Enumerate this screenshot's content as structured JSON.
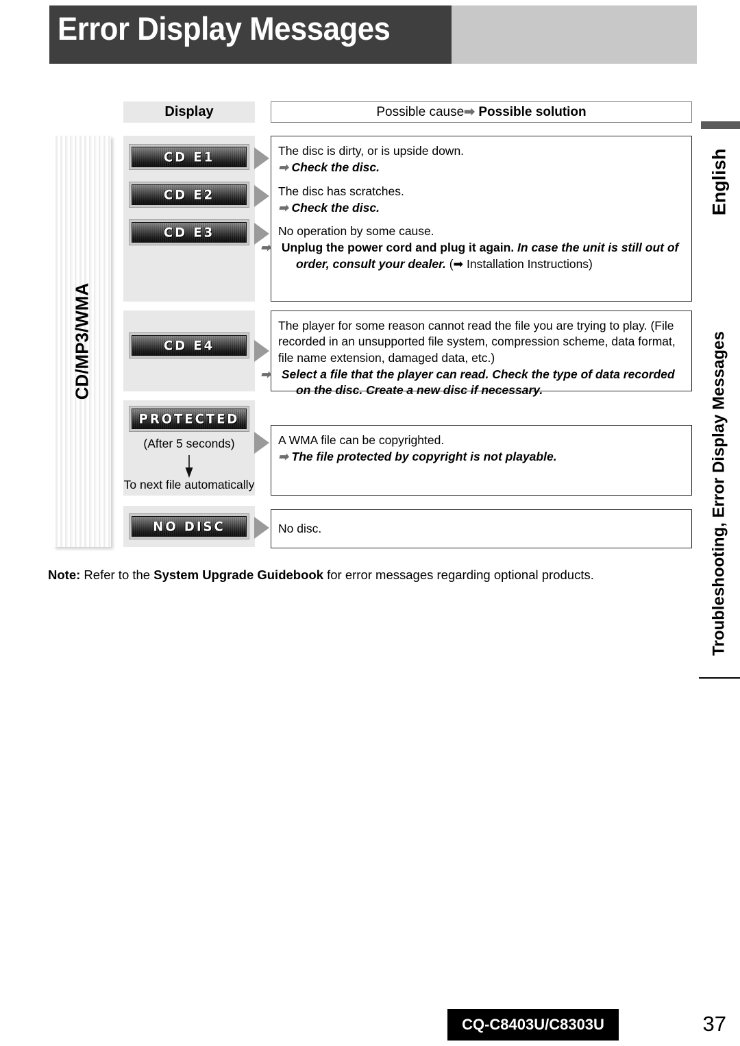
{
  "page": {
    "title": "Error Display Messages",
    "category_tab": "CD/MP3/WMA",
    "language_label": "English",
    "section_label": "Troubleshooting, Error Display Messages",
    "note_prefix": "Note:",
    "note_text_1": " Refer to the ",
    "note_bold": "System Upgrade Guidebook",
    "note_text_2": " for error messages regarding optional products.",
    "footer_model": "CQ-C8403U/C8303U",
    "page_number": "37"
  },
  "table": {
    "headers": {
      "display": "Display",
      "cause_prefix": "Possible cause ",
      "cause_arrow": "➡",
      "cause_bold": "Possible solution"
    },
    "rows": [
      {
        "displays": [
          "CD  E1",
          "CD  E2",
          "CD  E3"
        ],
        "entries": [
          {
            "cause": "The disc is dirty, or is upside down.",
            "solution": "Check the disc."
          },
          {
            "cause": "The disc has scratches.",
            "solution": "Check the disc."
          },
          {
            "cause": "No operation by some cause.",
            "solution_a": "Unplug the power cord and plug it again. ",
            "solution_b": "In case the unit is still out of order, consult your dealer.",
            "solution_c": " (➡ Installation Instructions)"
          }
        ]
      },
      {
        "displays": [
          "CD  E4"
        ],
        "cause": "The player for some reason cannot read the file you are trying to play. (File recorded in an unsupported file system, compression scheme, data format, file name extension, damaged data, etc.)",
        "solution": "Select a file that the player can read. Check the type of data recorded on the disc. Create a new disc if necessary."
      },
      {
        "displays": [
          "PROTECTED"
        ],
        "sub_note_1": "(After 5 seconds)",
        "sub_note_2": "To next file automatically",
        "cause": "A WMA file can be copyrighted.",
        "solution": "The file protected by copyright is not playable."
      },
      {
        "displays": [
          "NO DISC"
        ],
        "cause": "No disc."
      }
    ]
  }
}
